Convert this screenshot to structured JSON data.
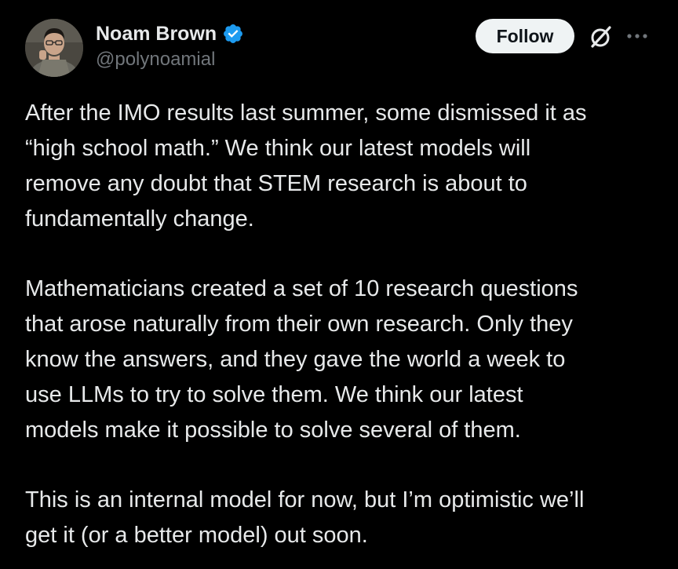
{
  "author": {
    "display_name": "Noam Brown",
    "handle": "@polynoamial",
    "verified": true,
    "avatar_icon": "user-avatar"
  },
  "actions": {
    "follow_label": "Follow",
    "grok_icon": "grok-icon",
    "more_icon": "more-horizontal-icon"
  },
  "tweet": {
    "paragraphs": [
      {
        "lines": [
          "After the IMO results last summer, some dismissed it as",
          "“high school math.” We think our latest models will",
          "remove any doubt that STEM research is about to",
          "fundamentally change."
        ]
      },
      {
        "lines": [
          "Mathematicians created a set of 10 research questions",
          "that arose naturally from their own research. Only they",
          "know the answers, and they gave the world a week to",
          "use LLMs to try to solve them. We think our latest",
          "models make it possible to solve several of them."
        ]
      },
      {
        "lines": [
          "This is an internal model for now, but I’m optimistic we’ll",
          "get it (or a better model) out soon."
        ]
      }
    ]
  },
  "colors": {
    "background": "#000000",
    "text_primary": "#e7e9ea",
    "text_secondary": "#71767b",
    "verified_badge": "#1d9bf0",
    "follow_button_bg": "#eff3f4",
    "follow_button_text": "#0f1419"
  }
}
